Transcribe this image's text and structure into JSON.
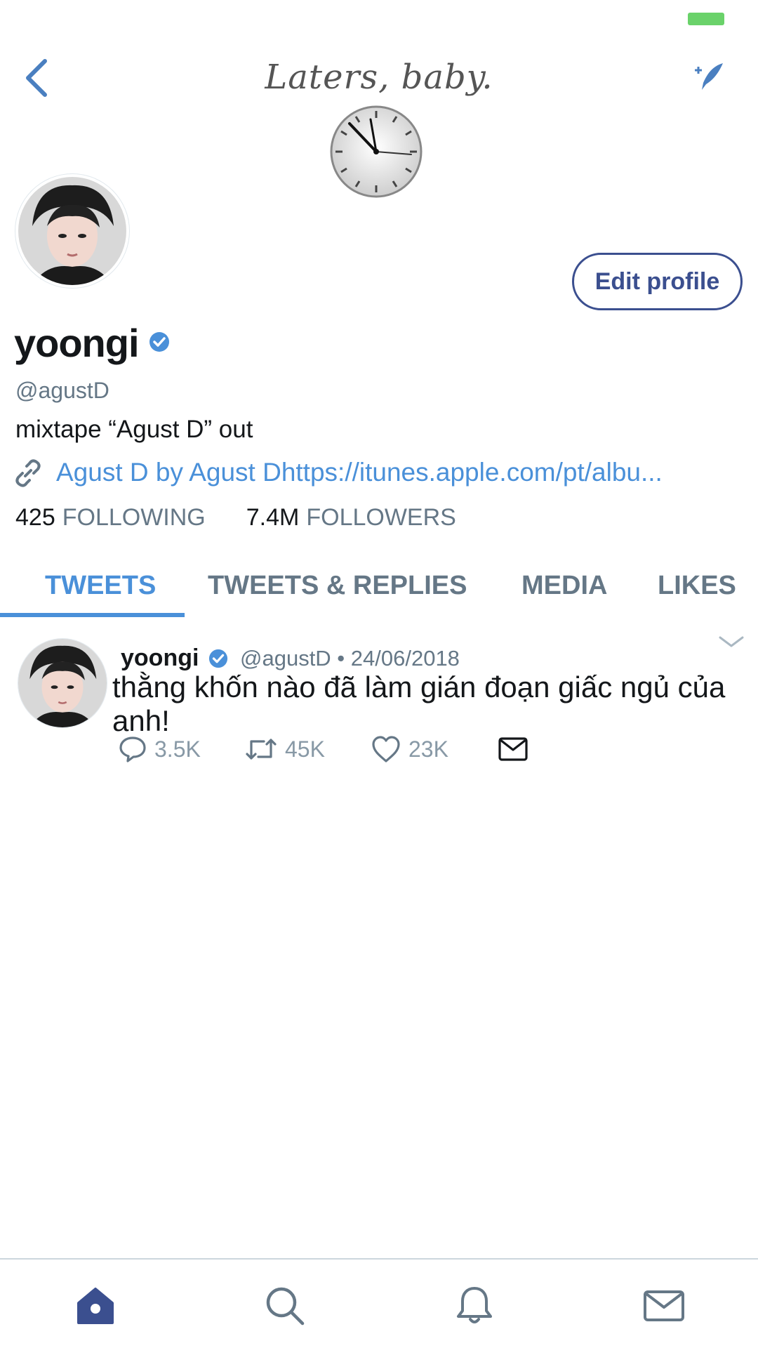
{
  "header": {
    "title": "Laters, baby."
  },
  "profile": {
    "display_name": "yoongi",
    "handle": "@agustD",
    "bio": "mixtape “Agust D” out",
    "link": "Agust D by Agust Dhttps://itunes.apple.com/pt/albu...",
    "edit_label": "Edit profile",
    "following_count": "425",
    "following_label": "FOLLOWING",
    "followers_count": "7.4M",
    "followers_label": "FOLLOWERS"
  },
  "tabs": [
    {
      "label": "TWEETS",
      "active": true
    },
    {
      "label": "TWEETS & REPLIES",
      "active": false
    },
    {
      "label": "MEDIA",
      "active": false
    },
    {
      "label": "LIKES",
      "active": false
    }
  ],
  "tweet": {
    "name": "yoongi",
    "meta": "@agustD • 24/06/2018",
    "text": "thằng khốn nào đã làm gián đoạn giấc ngủ của anh!",
    "replies": "3.5K",
    "retweets": "45K",
    "likes": "23K"
  },
  "colors": {
    "accent": "#4a90d9",
    "nav_active": "#3b4f8f",
    "muted": "#657786",
    "battery": "#6ad26a"
  },
  "icons": {
    "header": [
      "chevron-left-icon",
      "compose-feather-icon",
      "clock-icon"
    ],
    "profile": [
      "verified-icon",
      "link-icon"
    ],
    "tweet": [
      "reply-icon",
      "retweet-icon",
      "like-icon",
      "dm-icon",
      "caret-down-icon"
    ],
    "nav": [
      "home-icon",
      "search-icon",
      "notifications-icon",
      "messages-icon"
    ]
  }
}
